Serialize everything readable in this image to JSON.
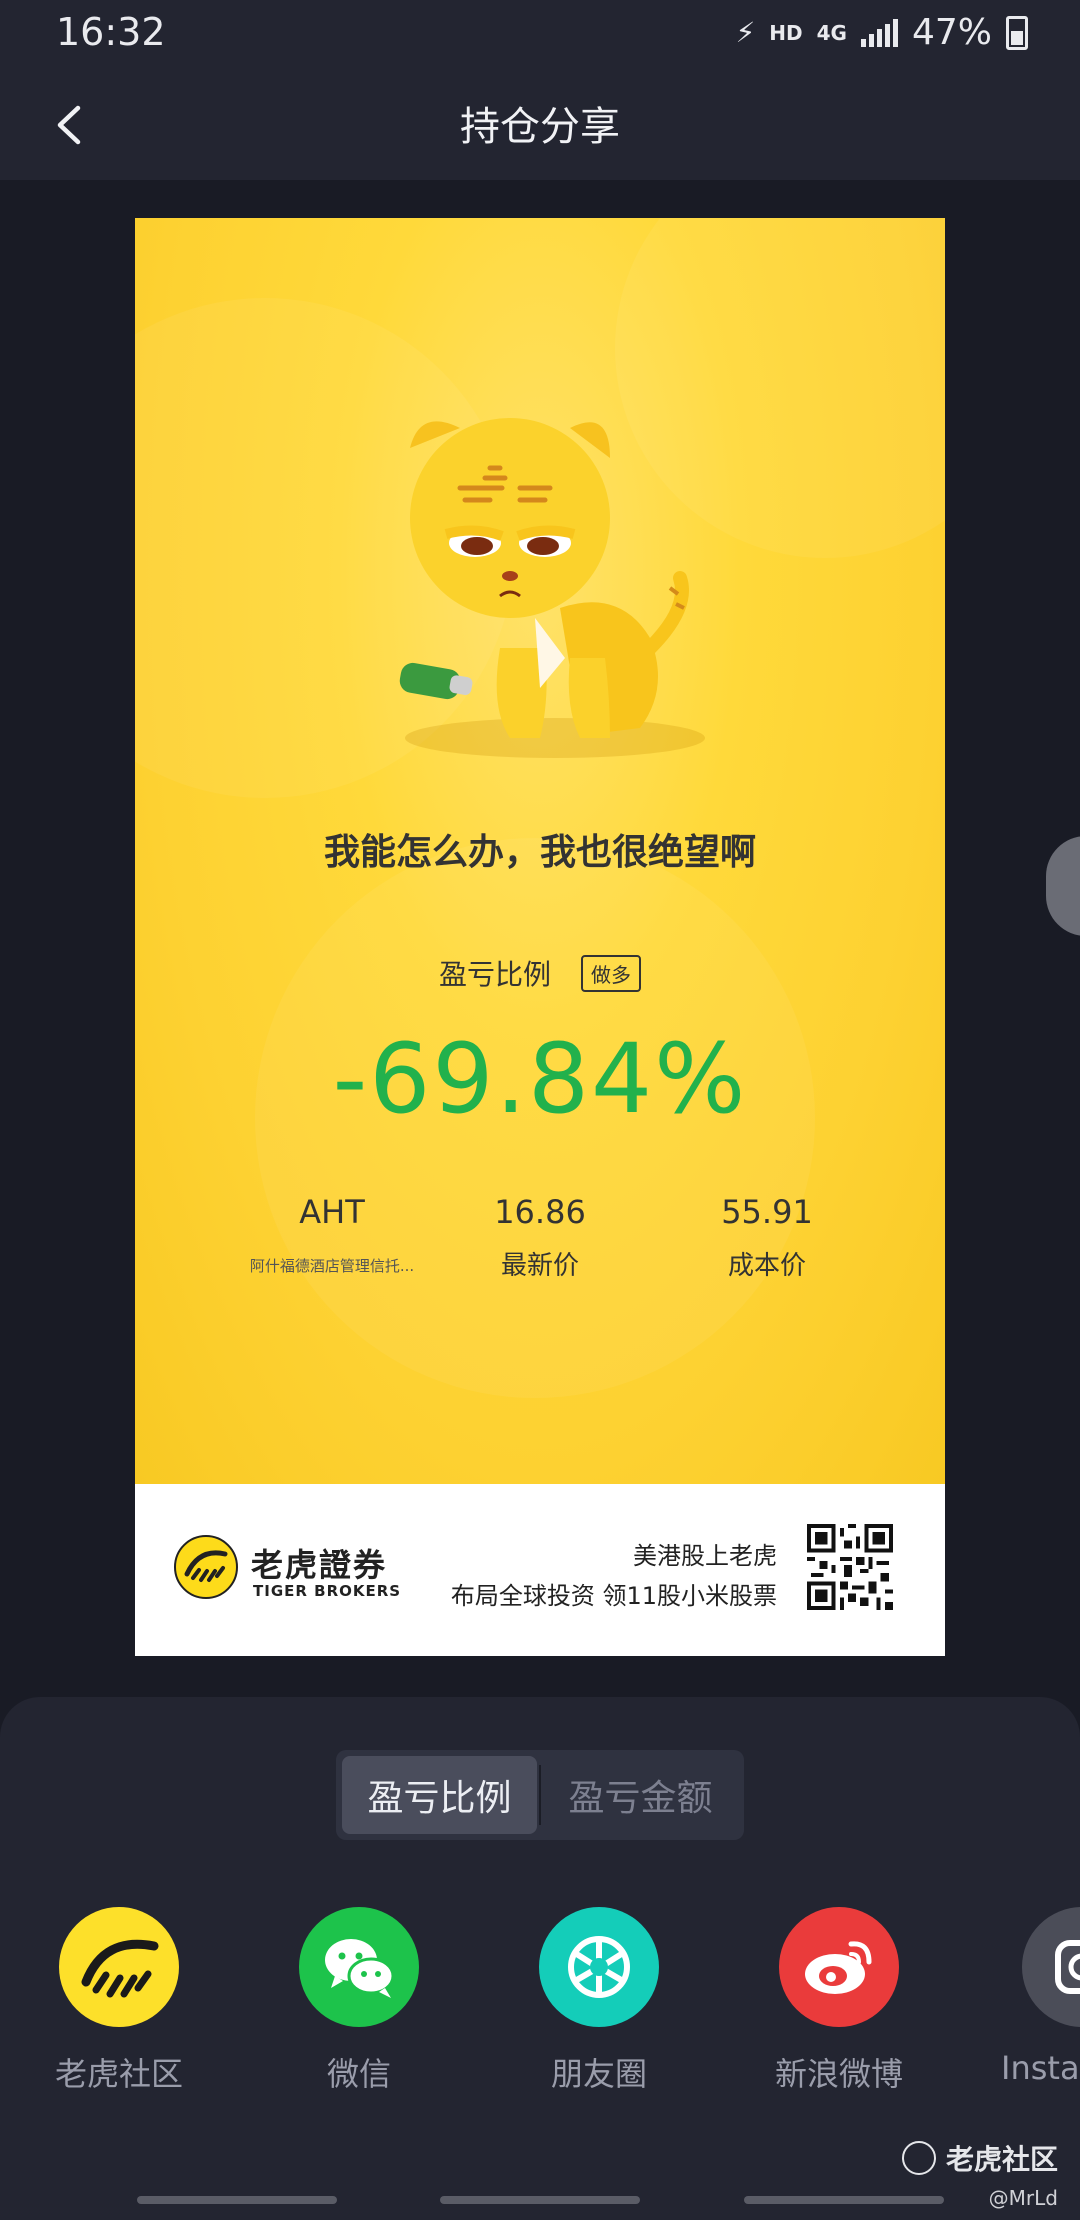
{
  "status_bar": {
    "time": "16:32",
    "network_hd": "HD",
    "network_4g": "4G",
    "battery": "47%"
  },
  "nav": {
    "title": "持仓分享",
    "back_icon": "chevron-left-icon"
  },
  "card": {
    "slogan": "我能怎么办，我也很绝望啊",
    "ratio_label": "盈亏比例",
    "ratio_tag": "做多",
    "ratio_value": "-69.84%",
    "ratio_color": "#22b14c",
    "background_color": "#fdd131",
    "stock": {
      "symbol": "AHT",
      "name": "阿什福德酒店管理信托..."
    },
    "latest_price": {
      "value": "16.86",
      "label": "最新价"
    },
    "cost_price": {
      "value": "55.91",
      "label": "成本价"
    },
    "footer": {
      "brand_cn": "老虎證券",
      "brand_en": "TIGER BROKERS",
      "promo_line1": "美港股上老虎",
      "promo_line2": "布局全球投资 领11股小米股票"
    }
  },
  "toggle": {
    "options": [
      "盈亏比例",
      "盈亏金额"
    ],
    "selected": "盈亏比例"
  },
  "share_targets": [
    {
      "label": "老虎社区",
      "icon": "tiger-community-icon",
      "color": "#fde02a"
    },
    {
      "label": "微信",
      "icon": "wechat-icon",
      "color": "#1dc34b"
    },
    {
      "label": "朋友圈",
      "icon": "moments-icon",
      "color": "#14cdb9"
    },
    {
      "label": "新浪微博",
      "icon": "weibo-icon",
      "color": "#ea3b3b"
    },
    {
      "label": "Instagram",
      "icon": "instagram-icon",
      "color": "#4b4d58"
    }
  ],
  "watermark": {
    "text": "老虎社区",
    "user": "@MrLd"
  }
}
